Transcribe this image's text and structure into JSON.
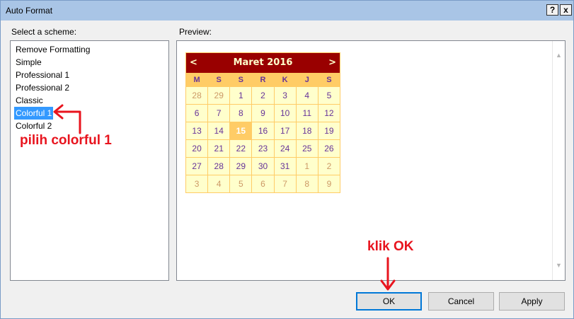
{
  "window": {
    "title": "Auto Format",
    "help_label": "?",
    "close_label": "x"
  },
  "schemes": {
    "label": "Select a scheme:",
    "items": [
      {
        "label": "Remove Formatting",
        "selected": false
      },
      {
        "label": "Simple",
        "selected": false
      },
      {
        "label": "Professional 1",
        "selected": false
      },
      {
        "label": "Professional 2",
        "selected": false
      },
      {
        "label": "Classic",
        "selected": false
      },
      {
        "label": "Colorful 1",
        "selected": true
      },
      {
        "label": "Colorful 2",
        "selected": false
      }
    ]
  },
  "preview": {
    "label": "Preview:",
    "calendar": {
      "prev": "<",
      "next": ">",
      "month": "Maret 2016",
      "weekdays": [
        "M",
        "S",
        "S",
        "R",
        "K",
        "J",
        "S"
      ],
      "weeks": [
        [
          {
            "d": "28",
            "o": true
          },
          {
            "d": "29",
            "o": true
          },
          {
            "d": "1"
          },
          {
            "d": "2"
          },
          {
            "d": "3"
          },
          {
            "d": "4"
          },
          {
            "d": "5"
          }
        ],
        [
          {
            "d": "6"
          },
          {
            "d": "7"
          },
          {
            "d": "8"
          },
          {
            "d": "9"
          },
          {
            "d": "10"
          },
          {
            "d": "11"
          },
          {
            "d": "12"
          }
        ],
        [
          {
            "d": "13"
          },
          {
            "d": "14"
          },
          {
            "d": "15",
            "t": true
          },
          {
            "d": "16"
          },
          {
            "d": "17"
          },
          {
            "d": "18"
          },
          {
            "d": "19"
          }
        ],
        [
          {
            "d": "20"
          },
          {
            "d": "21"
          },
          {
            "d": "22"
          },
          {
            "d": "23"
          },
          {
            "d": "24"
          },
          {
            "d": "25"
          },
          {
            "d": "26"
          }
        ],
        [
          {
            "d": "27"
          },
          {
            "d": "28"
          },
          {
            "d": "29"
          },
          {
            "d": "30"
          },
          {
            "d": "31"
          },
          {
            "d": "1",
            "o": true
          },
          {
            "d": "2",
            "o": true
          }
        ],
        [
          {
            "d": "3",
            "o": true
          },
          {
            "d": "4",
            "o": true
          },
          {
            "d": "5",
            "o": true
          },
          {
            "d": "6",
            "o": true
          },
          {
            "d": "7",
            "o": true
          },
          {
            "d": "8",
            "o": true
          },
          {
            "d": "9",
            "o": true
          }
        ]
      ]
    }
  },
  "buttons": {
    "ok": "OK",
    "cancel": "Cancel",
    "apply": "Apply"
  },
  "annotations": {
    "pick": "pilih colorful 1",
    "click_ok": "klik OK",
    "color": "#e8141e"
  },
  "colors": {
    "title_bg": "#990000",
    "title_fg": "#ffffcc",
    "dow_bg": "#ffcc66",
    "day_bg": "#ffffcc",
    "day_fg": "#663399",
    "other_fg": "#cc9966",
    "selection": "#3399ff"
  }
}
